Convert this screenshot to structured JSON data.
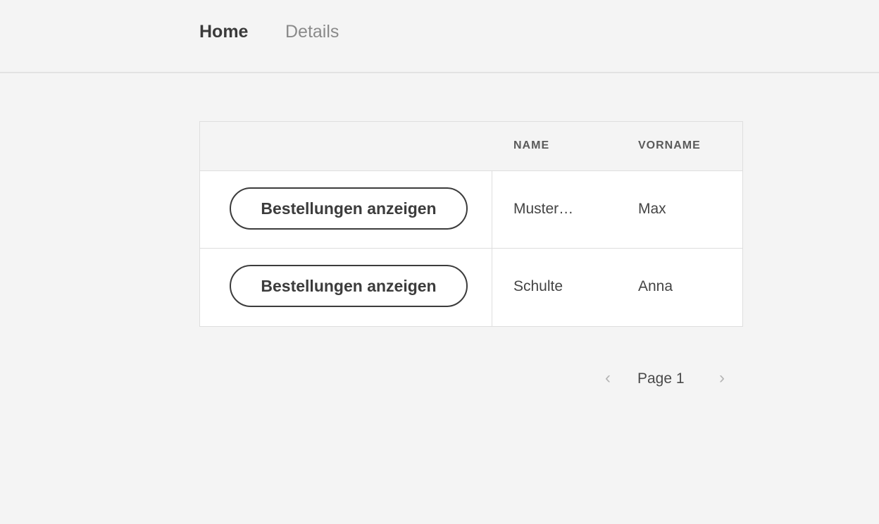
{
  "nav": {
    "tabs": [
      {
        "label": "Home",
        "active": true
      },
      {
        "label": "Details",
        "active": false
      }
    ]
  },
  "table": {
    "columns": [
      "",
      "NAME",
      "VORNAME"
    ],
    "rows": [
      {
        "action_label": "Bestellungen anzeigen",
        "name": "Muster…",
        "vorname": "Max"
      },
      {
        "action_label": "Bestellungen anzeigen",
        "name": "Schulte",
        "vorname": "Anna"
      }
    ]
  },
  "pager": {
    "prev_icon": "chevron-left-icon",
    "next_icon": "chevron-right-icon",
    "page_label": "Page 1"
  },
  "colors": {
    "background": "#f4f4f4",
    "table_bg": "#ffffff",
    "border": "#dedede",
    "text": "#3c3c3c",
    "muted": "#8a8a8a"
  }
}
